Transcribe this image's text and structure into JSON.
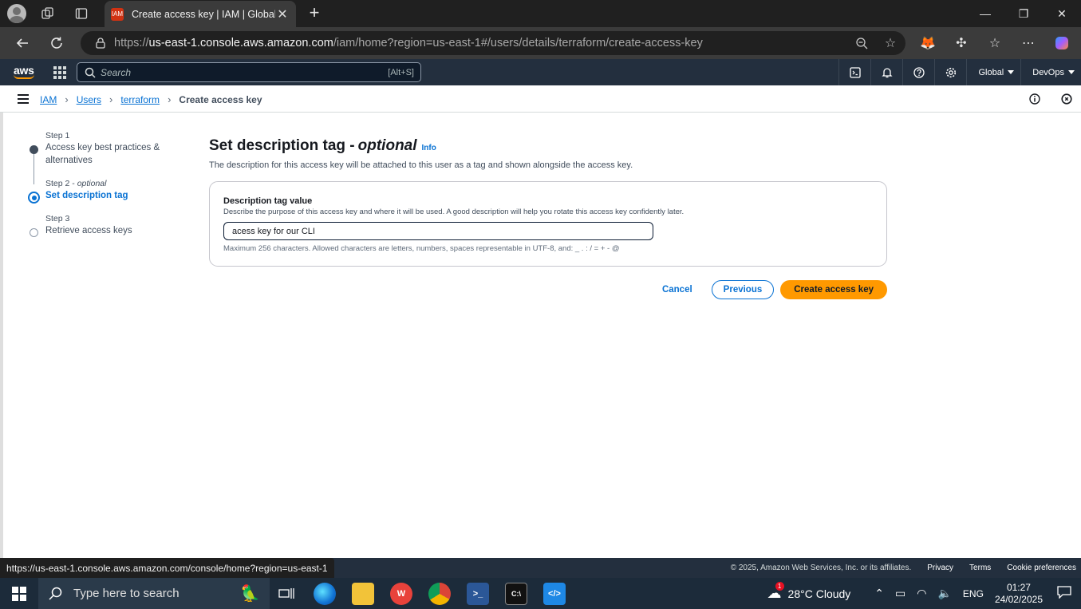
{
  "browser": {
    "tab_title": "Create access key | IAM | Global",
    "url_prefix": "https://",
    "url_host": "us-east-1.console.aws.amazon.com",
    "url_path": "/iam/home?region=us-east-1#/users/details/terraform/create-access-key",
    "favicon_text": "IAM"
  },
  "aws_header": {
    "logo": "aws",
    "search_placeholder": "Search",
    "search_shortcut": "[Alt+S]",
    "region": "Global",
    "account": "DevOps"
  },
  "breadcrumb": {
    "items": [
      "IAM",
      "Users",
      "terraform"
    ],
    "current": "Create access key"
  },
  "steps": [
    {
      "label": "Step 1",
      "title": "Access key best practices & alternatives"
    },
    {
      "label": "Step 2",
      "label_suffix": "optional",
      "title": "Set description tag"
    },
    {
      "label": "Step 3",
      "title": "Retrieve access keys"
    }
  ],
  "main": {
    "title": "Set description tag -",
    "title_optional": "optional",
    "info": "Info",
    "description": "The description for this access key will be attached to this user as a tag and shown alongside the access key.",
    "field_label": "Description tag value",
    "field_description": "Describe the purpose of this access key and where it will be used. A good description will help you rotate this access key confidently later.",
    "field_value": "acess key for our CLI",
    "field_hint": "Maximum 256 characters. Allowed characters are letters, numbers, spaces representable in UTF-8, and: _ . : / = + - @",
    "cancel": "Cancel",
    "previous": "Previous",
    "create": "Create access key"
  },
  "status_bar": {
    "url": "https://us-east-1.console.aws.amazon.com/console/home?region=us-east-1"
  },
  "footer": {
    "copyright": "© 2025, Amazon Web Services, Inc. or its affiliates.",
    "privacy": "Privacy",
    "terms": "Terms",
    "cookies": "Cookie preferences"
  },
  "taskbar": {
    "search_placeholder": "Type here to search",
    "weather": "28°C  Cloudy",
    "weather_badge": "1",
    "language": "ENG",
    "time": "01:27",
    "date": "24/02/2025"
  },
  "colors": {
    "aws_nav": "#232f3e",
    "link_blue": "#0972d3",
    "primary_orange": "#ff9900"
  }
}
